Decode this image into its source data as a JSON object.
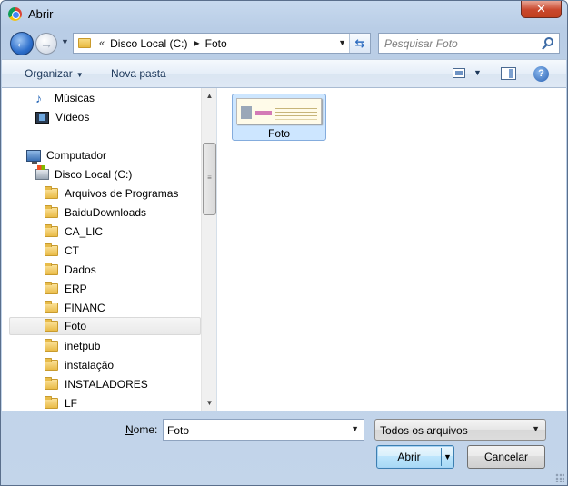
{
  "window": {
    "title": "Abrir",
    "close_label": "✕"
  },
  "address": {
    "chevron": "«",
    "crumbs": [
      "Disco Local (C:)",
      "Foto"
    ],
    "separator": "▶"
  },
  "search": {
    "placeholder": "Pesquisar Foto",
    "value": ""
  },
  "toolbar": {
    "organize_label": "Organizar",
    "new_folder_label": "Nova pasta",
    "help_label": "?"
  },
  "nav_tree": {
    "items": [
      {
        "label": "Músicas",
        "icon": "music-icon"
      },
      {
        "label": "Vídeos",
        "icon": "video-icon"
      },
      {
        "label": "Computador",
        "icon": "computer-icon"
      },
      {
        "label": "Disco Local (C:)",
        "icon": "disk-icon"
      },
      {
        "label": "Arquivos de Programas",
        "icon": "folder-icon"
      },
      {
        "label": "BaiduDownloads",
        "icon": "folder-icon"
      },
      {
        "label": "CA_LIC",
        "icon": "folder-icon"
      },
      {
        "label": "CT",
        "icon": "folder-icon"
      },
      {
        "label": "Dados",
        "icon": "folder-icon"
      },
      {
        "label": "ERP",
        "icon": "folder-icon"
      },
      {
        "label": "FINANC",
        "icon": "folder-icon"
      },
      {
        "label": "Foto",
        "icon": "folder-icon",
        "selected": true
      },
      {
        "label": "inetpub",
        "icon": "folder-icon"
      },
      {
        "label": "instalação",
        "icon": "folder-icon"
      },
      {
        "label": "INSTALADORES",
        "icon": "folder-icon"
      },
      {
        "label": "LF",
        "icon": "folder-icon"
      }
    ]
  },
  "files": [
    {
      "name": "Foto",
      "selected": true
    }
  ],
  "bottom": {
    "name_label_prefix": "N",
    "name_label_rest": "ome:",
    "name_value": "Foto",
    "filter_value": "Todos os arquivos",
    "open_label": "Abrir",
    "cancel_label": "Cancelar"
  }
}
